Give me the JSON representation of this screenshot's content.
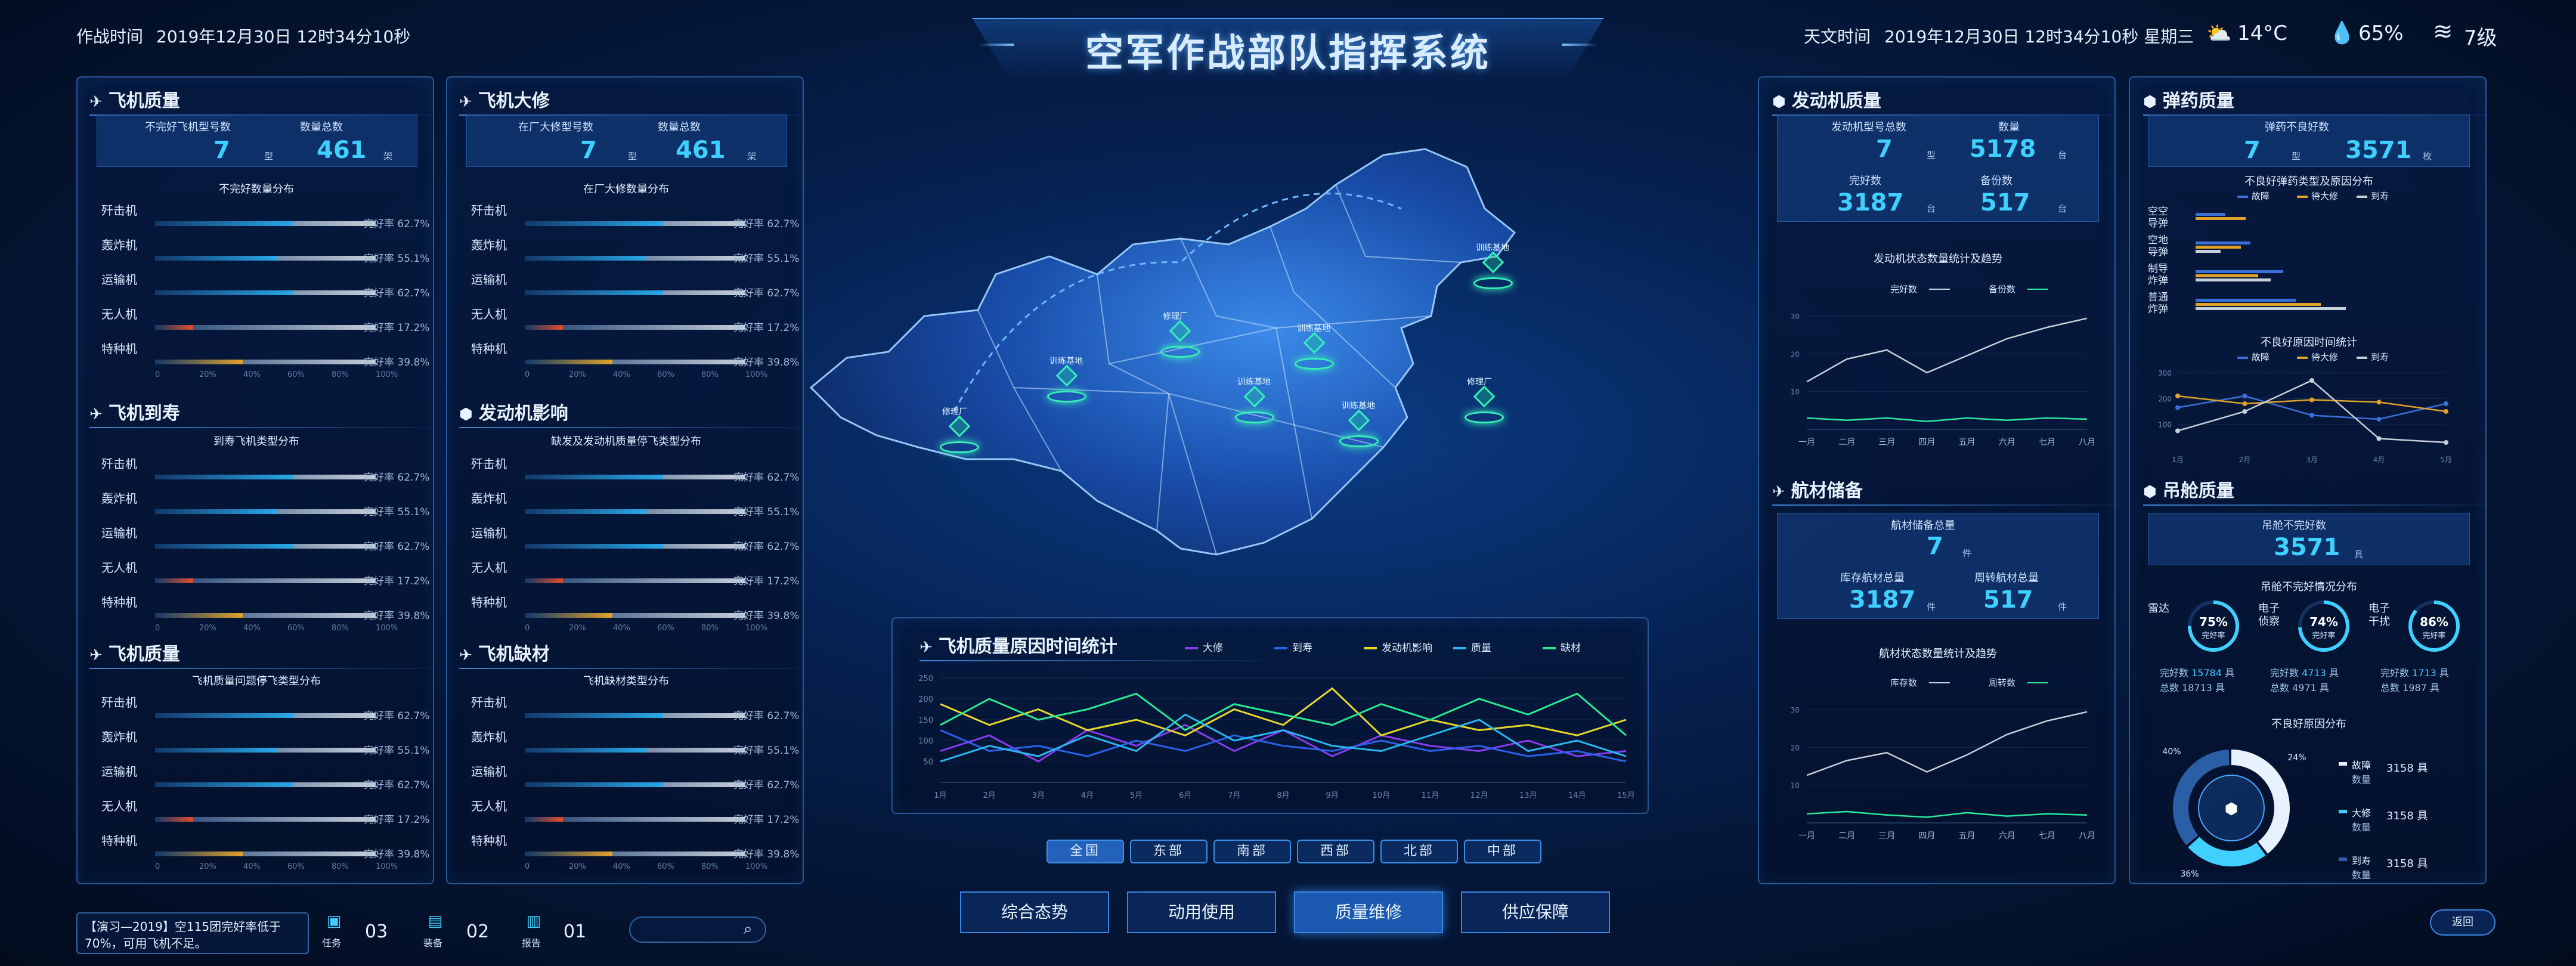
{
  "header": {
    "combat_time_label": "作战时间",
    "combat_time": "2019年12月30日 12时34分10秒",
    "title": "空军作战部队指挥系统",
    "astro_time_label": "天文时间",
    "astro_time": "2019年12月30日 12时34分10秒 星期三",
    "temperature": "14°C",
    "humidity": "65%",
    "wind": "7级"
  },
  "left1": {
    "s1": {
      "title": "飞机质量",
      "stat1_label": "不完好飞机型号数",
      "stat1_value": "7",
      "stat1_unit": "型",
      "stat2_label": "数量总数",
      "stat2_value": "461",
      "stat2_unit": "架",
      "caption": "不完好数量分布"
    },
    "s2": {
      "title": "飞机到寿",
      "caption": "到寿飞机类型分布"
    },
    "s3": {
      "title": "飞机质量",
      "caption": "飞机质量问题停飞类型分布"
    }
  },
  "left2": {
    "s1": {
      "title": "飞机大修",
      "stat1_label": "在厂大修型号数",
      "stat1_value": "7",
      "stat1_unit": "型",
      "stat2_label": "数量总数",
      "stat2_value": "461",
      "stat2_unit": "架",
      "caption": "在厂大修数量分布"
    },
    "s2": {
      "title": "发动机影响",
      "caption": "缺发及发动机质量停飞类型分布"
    },
    "s3": {
      "title": "飞机缺材",
      "caption": "飞机缺材类型分布"
    }
  },
  "bar_rows": [
    {
      "label": "歼击机",
      "value_text": "62.7%",
      "fill": 0.627,
      "color": "#2aa8e8"
    },
    {
      "label": "轰炸机",
      "value_text": "55.1%",
      "fill": 0.551,
      "color": "#2aa8e8"
    },
    {
      "label": "运输机",
      "value_text": "62.7%",
      "fill": 0.627,
      "color": "#2aa8e8"
    },
    {
      "label": "无人机",
      "value_text": "17.2%",
      "fill": 0.172,
      "color": "#e04d2a"
    },
    {
      "label": "特种机",
      "value_text": "39.8%",
      "fill": 0.398,
      "color": "#e0a22a"
    }
  ],
  "bar_rate_label": "完好率",
  "bar_axis": [
    "0",
    "20%",
    "40%",
    "60%",
    "80%",
    "100%"
  ],
  "map": {
    "markers": [
      "修理厂",
      "训练基地",
      "修理厂",
      "训练基地",
      "训练基地",
      "修理厂",
      "训练基地",
      "训练基地"
    ]
  },
  "center_chart": {
    "title": "飞机质量原因时间统计",
    "legend": [
      "大修",
      "到寿",
      "发动机影响",
      "质量",
      "缺材"
    ],
    "colors": [
      "#8a3cf0",
      "#2a62e8",
      "#e8d82a",
      "#2ab8f0",
      "#2ae890"
    ],
    "x_labels": [
      "1月",
      "2月",
      "3月",
      "4月",
      "5月",
      "6月",
      "7月",
      "8月",
      "9月",
      "10月",
      "11月",
      "12月",
      "13月",
      "14月",
      "15月"
    ],
    "y_labels": [
      "50",
      "100",
      "150",
      "200",
      "250"
    ]
  },
  "region_tabs": [
    "全国",
    "东部",
    "南部",
    "西部",
    "北部",
    "中部"
  ],
  "bottom_nav": [
    "综合态势",
    "动用使用",
    "质量维修",
    "供应保障"
  ],
  "bottom_status": {
    "notice": "【演习—2019】空115团完好率低于70%，可用飞机不足。",
    "task_label": "任务",
    "task_count": "03",
    "equip_label": "装备",
    "equip_count": "02",
    "report_label": "报告",
    "report_count": "01",
    "return_label": "返回"
  },
  "right1": {
    "engine": {
      "title": "发动机质量",
      "stat1_label": "发动机型号总数",
      "stat1_value": "7",
      "stat1_unit": "型",
      "stat2_label": "数量",
      "stat2_value": "5178",
      "stat2_unit": "台",
      "stat3_label": "完好数",
      "stat3_value": "3187",
      "stat3_unit": "台",
      "stat4_label": "备份数",
      "stat4_value": "517",
      "stat4_unit": "台",
      "chart_caption": "发动机状态数量统计及趋势",
      "legend1": "完好数",
      "legend2": "备份数",
      "months": [
        "一月",
        "二月",
        "三月",
        "四月",
        "五月",
        "六月",
        "七月",
        "八月"
      ],
      "y_labels": [
        "10",
        "20",
        "30"
      ]
    },
    "material": {
      "title": "航材储备",
      "stat1_label": "航材储备总量",
      "stat1_value": "7",
      "stat1_unit": "件",
      "stat2_label": "库存航材总量",
      "stat2_value": "3187",
      "stat2_unit": "件",
      "stat3_label": "周转航材总量",
      "stat3_value": "517",
      "stat3_unit": "件",
      "chart_caption": "航材状态数量统计及趋势",
      "legend1": "库存数",
      "legend2": "周转数",
      "months": [
        "一月",
        "二月",
        "三月",
        "四月",
        "五月",
        "六月",
        "七月",
        "八月"
      ],
      "y_labels": [
        "10",
        "20",
        "30"
      ]
    }
  },
  "right2": {
    "ammo": {
      "title": "弹药质量",
      "stat1_label": "弹药不良好数",
      "stat1_value": "7",
      "stat1_unit": "型",
      "stat2_value": "3571",
      "stat2_unit": "枚",
      "caption": "不良好弹药类型及原因分布",
      "legend": [
        "故障",
        "待大修",
        "到寿"
      ],
      "categories": [
        "空空导弹",
        "空地导弹",
        "制导炸弹",
        "普通炸弹"
      ],
      "chart2_caption": "不良好原因时间统计",
      "chart2_y": [
        "100",
        "200",
        "300"
      ],
      "chart2_x": [
        "1月",
        "2月",
        "3月",
        "4月",
        "5月"
      ]
    },
    "pod": {
      "title": "吊舱质量",
      "stat_label": "吊舱不完好数",
      "stat_value": "3571",
      "stat_unit": "具",
      "caption": "吊舱不完好情况分布",
      "gauges": [
        {
          "name": "雷达",
          "pct": "75%",
          "ratio": 0.75,
          "sub": "完好率",
          "ok_label": "完好数",
          "ok": "15784",
          "total_label": "总数",
          "total": "18713"
        },
        {
          "name": "电子侦察",
          "pct": "74%",
          "ratio": 0.74,
          "sub": "完好率",
          "ok_label": "完好数",
          "ok": "4713",
          "total_label": "总数",
          "total": "4971"
        },
        {
          "name": "电子干扰",
          "pct": "86%",
          "ratio": 0.86,
          "sub": "完好率",
          "ok_label": "完好数",
          "ok": "1713",
          "total_label": "总数",
          "total": "1987"
        }
      ],
      "unit": "具",
      "donut_caption": "不良好原因分布",
      "donut_pcts": [
        "40%",
        "24%",
        "36%"
      ],
      "donut_legend": [
        {
          "name": "故障",
          "label": "数量",
          "value": "3158",
          "color": "#e8f2ff"
        },
        {
          "name": "大修",
          "label": "数量",
          "value": "3158",
          "color": "#3fd0ff"
        },
        {
          "name": "到寿",
          "label": "数量",
          "value": "3158",
          "color": "#2a5fa8"
        }
      ]
    }
  }
}
